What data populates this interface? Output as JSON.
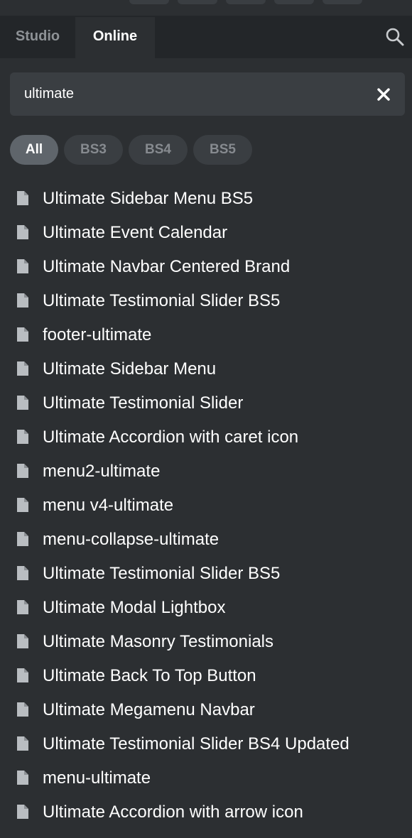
{
  "tabs": {
    "studio": "Studio",
    "online": "Online"
  },
  "search": {
    "value": "ultimate",
    "placeholder": ""
  },
  "filters": {
    "all": "All",
    "bs3": "BS3",
    "bs4": "BS4",
    "bs5": "BS5"
  },
  "items": [
    "Ultimate Sidebar Menu BS5",
    "Ultimate Event Calendar",
    "Ultimate Navbar Centered Brand",
    "Ultimate Testimonial Slider BS5",
    "footer-ultimate",
    "Ultimate Sidebar Menu",
    "Ultimate Testimonial Slider",
    "Ultimate Accordion with caret icon",
    "menu2-ultimate",
    "menu v4-ultimate",
    "menu-collapse-ultimate",
    "Ultimate Testimonial Slider BS5",
    "Ultimate Modal Lightbox",
    "Ultimate Masonry Testimonials",
    "Ultimate Back To Top Button",
    "Ultimate Megamenu Navbar",
    "Ultimate Testimonial Slider BS4 Updated",
    "menu-ultimate",
    "Ultimate Accordion with arrow icon"
  ],
  "colors": {
    "background": "#2c2f32",
    "tabbar": "#232629",
    "field": "#3a3e42",
    "active_pill": "#5f656b",
    "muted_text": "#8e9296"
  },
  "icons": {
    "search_toggle": "search-icon",
    "clear": "close-icon",
    "list_item": "file-icon"
  }
}
